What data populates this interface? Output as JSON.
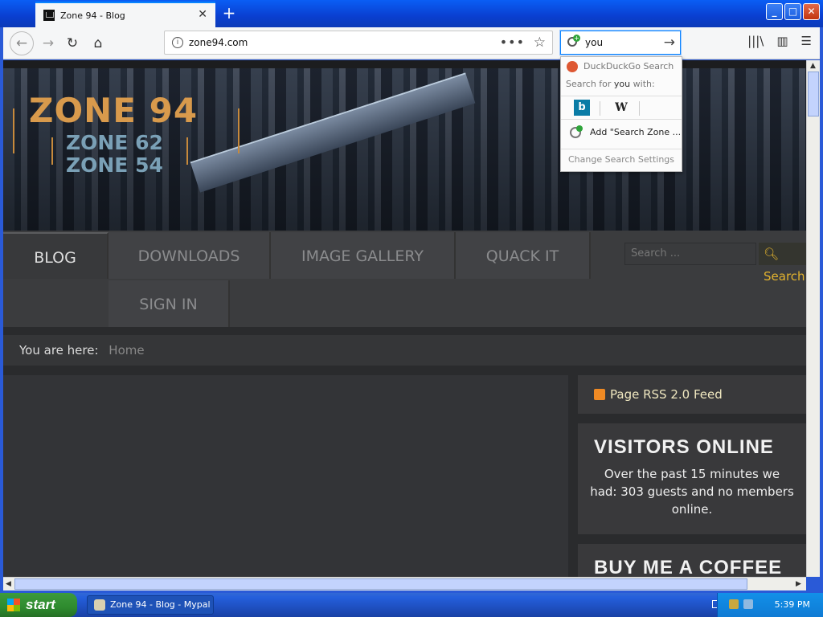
{
  "browser": {
    "tab_title": "Zone 94 - Blog",
    "url": "zone94.com",
    "search_value": "you"
  },
  "search_dropdown": {
    "engine": "DuckDuckGo Search",
    "search_for_prefix": "Search for ",
    "search_for_query": "you",
    "search_for_suffix": " with:",
    "wiki_label": "W",
    "bing_label": "b",
    "add_engine": "Add \"Search Zone ...",
    "change_settings": "Change Search Settings"
  },
  "site": {
    "logo_main": "ZONE 94",
    "logo_sub1": "ZONE 62",
    "logo_sub2": "ZONE 54",
    "menu": [
      "BLOG",
      "DOWNLOADS",
      "IMAGE GALLERY",
      "QUACK IT",
      "SIGN IN"
    ],
    "search_placeholder": "Search ...",
    "search_button": "Search",
    "breadcrumb_label": "You are here:",
    "breadcrumb_home": "Home",
    "rss": "Page RSS 2.0 Feed",
    "visitors_title": "VISITORS ONLINE",
    "visitors_text": "Over the past 15 minutes we had: 303 guests and no members online.",
    "coffee_title": "BUY ME A COFFEE"
  },
  "taskbar": {
    "start": "start",
    "item": "Zone 94 - Blog - Mypal",
    "time": "5:39 PM"
  },
  "icons": [
    "back-icon",
    "forward-icon",
    "reload-icon",
    "home-icon",
    "info-icon",
    "more-icon",
    "star-icon",
    "search-add-icon",
    "go-arrow-icon",
    "library-icon",
    "sidebar-icon",
    "menu-icon",
    "close-icon",
    "plus-icon",
    "duckduckgo-icon",
    "bing-icon",
    "wikipedia-icon",
    "rss-icon",
    "windows-flag-icon"
  ]
}
